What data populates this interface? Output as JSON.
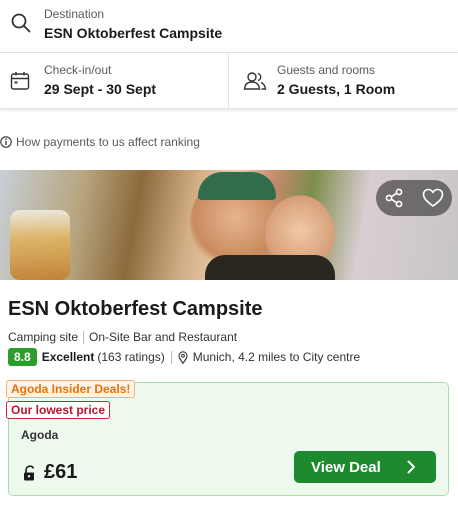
{
  "search": {
    "destination_label": "Destination",
    "destination_value": "ESN Oktoberfest Campsite",
    "checkin_label": "Check-in/out",
    "checkin_value": "29 Sept - 30 Sept",
    "guests_label": "Guests and rooms",
    "guests_value": "2 Guests, 1 Room"
  },
  "info_note": "How payments to us affect ranking",
  "listing": {
    "name": "ESN Oktoberfest Campsite",
    "type": "Camping site",
    "feature": "On-Site Bar and Restaurant",
    "score": "8.8",
    "rating_word": "Excellent",
    "rating_count": "(163 ratings)",
    "location": "Munich, 4.2 miles to City centre"
  },
  "deal": {
    "badge_insider": "Agoda Insider Deals!",
    "badge_lowest": "Our lowest price",
    "provider": "Agoda",
    "price": "£61",
    "button_label": "View Deal"
  },
  "colors": {
    "accent_green": "#1e8a2e",
    "score_green": "#2a9d2a",
    "insider_orange": "#e4730b",
    "lowest_red": "#b0192f"
  },
  "icons": [
    "search-icon",
    "calendar-icon",
    "guests-icon",
    "info-icon",
    "share-icon",
    "heart-icon",
    "location-pin-icon",
    "unlock-icon",
    "chevron-right-icon"
  ]
}
